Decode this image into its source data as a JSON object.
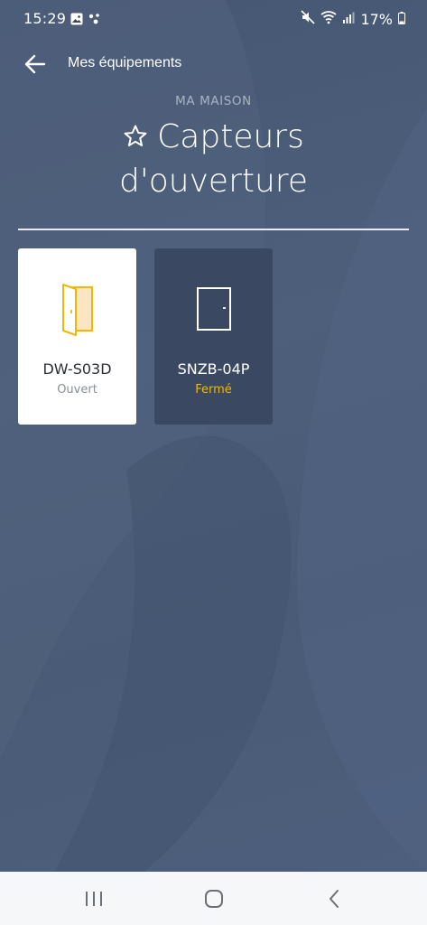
{
  "status_bar": {
    "time": "15:29",
    "battery_text": "17%",
    "icons": [
      "image-icon",
      "assistant-dots-icon",
      "mute-icon",
      "wifi-icon",
      "signal-icon",
      "battery-icon"
    ]
  },
  "header": {
    "back_icon": "arrow-left-icon",
    "title": "Mes équipements"
  },
  "section_caption": "MA MAISON",
  "page_title": {
    "line1": "Capteurs",
    "line2": "d'ouverture",
    "favorite_icon": "star-outline-icon"
  },
  "devices": [
    {
      "name": "DW-S03D",
      "state": "Ouvert",
      "icon": "door-open-icon"
    },
    {
      "name": "SNZB-04P",
      "state": "Fermé",
      "icon": "door-closed-icon"
    }
  ],
  "nav_bar": {
    "icons": [
      "recents-icon",
      "home-icon",
      "back-icon"
    ]
  },
  "colors": {
    "background": "#4a5c78",
    "accent_yellow": "#f2b705",
    "card_selected": "#ffffff",
    "card_dark": "#3b4861"
  }
}
